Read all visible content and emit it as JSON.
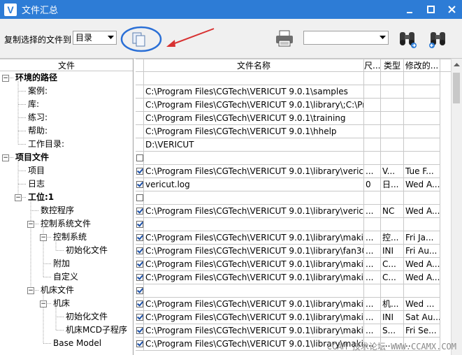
{
  "window": {
    "title": "文件汇总",
    "app_icon": "V"
  },
  "toolbar": {
    "label": "复制选择的文件到",
    "select_value": "目录",
    "combo2_value": ""
  },
  "tree": {
    "header": "文件",
    "items": [
      {
        "label": "环境的路径",
        "level": 0,
        "bold": true,
        "expander": "minus"
      },
      {
        "label": "案例:",
        "level": 1
      },
      {
        "label": "库:",
        "level": 1
      },
      {
        "label": "练习:",
        "level": 1
      },
      {
        "label": "帮助:",
        "level": 1
      },
      {
        "label": "工作目录:",
        "level": 1
      },
      {
        "label": "项目文件",
        "level": 0,
        "bold": true,
        "expander": "minus"
      },
      {
        "label": "项目",
        "level": 1
      },
      {
        "label": "日志",
        "level": 1
      },
      {
        "label": "工位:1",
        "level": 1,
        "bold": true,
        "expander": "minus"
      },
      {
        "label": "数控程序",
        "level": 2
      },
      {
        "label": "控制系统文件",
        "level": 2,
        "expander": "minus"
      },
      {
        "label": "控制系统",
        "level": 3,
        "expander": "minus"
      },
      {
        "label": "初始化文件",
        "level": 4
      },
      {
        "label": "附加",
        "level": 3
      },
      {
        "label": "自定义",
        "level": 3
      },
      {
        "label": "机床文件",
        "level": 2,
        "expander": "minus"
      },
      {
        "label": "机床",
        "level": 3,
        "expander": "minus"
      },
      {
        "label": "初始化文件",
        "level": 4
      },
      {
        "label": "机床MCD子程序",
        "level": 4
      },
      {
        "label": "Base Model",
        "level": 3
      }
    ]
  },
  "grid": {
    "headers": [
      "文件名称",
      "尺...",
      "类型",
      "修改的..."
    ],
    "rows": [
      {
        "check": null,
        "name": "",
        "size": "",
        "type": "",
        "modified": ""
      },
      {
        "check": null,
        "name": "C:\\Program Files\\CGTech\\VERICUT 9.0.1\\samples",
        "size": "",
        "type": "",
        "modified": ""
      },
      {
        "check": null,
        "name": "C:\\Program Files\\CGTech\\VERICUT 9.0.1\\library\\;C:\\Pro...",
        "size": "",
        "type": "",
        "modified": ""
      },
      {
        "check": null,
        "name": "C:\\Program Files\\CGTech\\VERICUT 9.0.1\\training",
        "size": "",
        "type": "",
        "modified": ""
      },
      {
        "check": null,
        "name": "C:\\Program Files\\CGTech\\VERICUT 9.0.1\\hhelp",
        "size": "",
        "type": "",
        "modified": ""
      },
      {
        "check": null,
        "name": "D:\\VERICUT",
        "size": "",
        "type": "",
        "modified": ""
      },
      {
        "check": "off",
        "name": "",
        "size": "",
        "type": "",
        "modified": ""
      },
      {
        "check": "on",
        "name": "C:\\Program Files\\CGTech\\VERICUT 9.0.1\\library\\vericut...",
        "size": "...",
        "type": "V...",
        "modified": "Tue F..."
      },
      {
        "check": "on",
        "name": "vericut.log",
        "size": "0",
        "type": "日...",
        "modified": "Wed A..."
      },
      {
        "check": "off",
        "name": "",
        "size": "",
        "type": "",
        "modified": ""
      },
      {
        "check": "on",
        "name": "C:\\Program Files\\CGTech\\VERICUT 9.0.1\\library\\vericut...",
        "size": "...",
        "type": "NC",
        "modified": "Wed A..."
      },
      {
        "check": "on",
        "name": "",
        "size": "",
        "type": "",
        "modified": ""
      },
      {
        "check": "on",
        "name": "C:\\Program Files\\CGTech\\VERICUT 9.0.1\\library\\makin...",
        "size": "...",
        "type": "控...",
        "modified": "Fri Ja..."
      },
      {
        "check": "on",
        "name": "C:\\Program Files\\CGTech\\VERICUT 9.0.1\\library\\fan30i...",
        "size": "...",
        "type": "INI",
        "modified": "Fri Au..."
      },
      {
        "check": "on",
        "name": "C:\\Program Files\\CGTech\\VERICUT 9.0.1\\library\\makin...",
        "size": "...",
        "type": "C...",
        "modified": "Wed A..."
      },
      {
        "check": "on",
        "name": "C:\\Program Files\\CGTech\\VERICUT 9.0.1\\library\\makin...",
        "size": "...",
        "type": "C...",
        "modified": "Wed A..."
      },
      {
        "check": "on",
        "name": "",
        "size": "",
        "type": "",
        "modified": ""
      },
      {
        "check": "on",
        "name": "C:\\Program Files\\CGTech\\VERICUT 9.0.1\\library\\makin...",
        "size": "...",
        "type": "机...",
        "modified": "Wed ..."
      },
      {
        "check": "on",
        "name": "C:\\Program Files\\CGTech\\VERICUT 9.0.1\\library\\makin...",
        "size": "...",
        "type": "INI",
        "modified": "Sat Au..."
      },
      {
        "check": "on",
        "name": "C:\\Program Files\\CGTech\\VERICUT 9.0.1\\library\\makin...",
        "size": "...",
        "type": "S...",
        "modified": "Fri Se..."
      },
      {
        "check": "on",
        "name": "C:\\Program Files\\CGTech\\VERICUT 9.0.1\\library\\makin...",
        "size": "...",
        "type": "...",
        "modified": "..."
      }
    ]
  },
  "watermark": "CCAM 技术论坛 WWW.CCAMX.COM",
  "colors": {
    "titlebar": "#2d7cd6",
    "annotation": "#2a6fd6",
    "arrow": "#d83232"
  },
  "icons": {
    "minimize": "minimize-icon",
    "maximize": "maximize-icon",
    "close": "close-icon",
    "copy": "copy-files-icon",
    "print": "printer-icon",
    "find": "binoculars-icon"
  }
}
